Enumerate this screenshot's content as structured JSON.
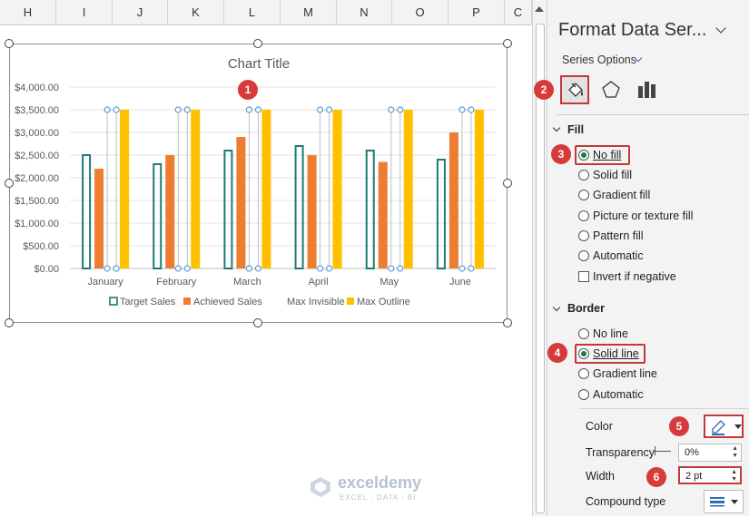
{
  "spreadsheet": {
    "columns": [
      "H",
      "I",
      "J",
      "K",
      "L",
      "M",
      "N",
      "O",
      "P",
      "C"
    ]
  },
  "chart_data": {
    "type": "bar",
    "title": "Chart Title",
    "categories": [
      "January",
      "February",
      "March",
      "April",
      "May",
      "June"
    ],
    "ylim": [
      0,
      4000
    ],
    "yticks": [
      "$0.00",
      "$500.00",
      "$1,000.00",
      "$1,500.00",
      "$2,000.00",
      "$2,500.00",
      "$3,000.00",
      "$3,500.00",
      "$4,000.00"
    ],
    "ytick_values": [
      0,
      500,
      1000,
      1500,
      2000,
      2500,
      3000,
      3500,
      4000
    ],
    "grid": true,
    "legend_position": "bottom",
    "series": [
      {
        "name": "Target Sales",
        "values": [
          2500,
          2300,
          2600,
          2700,
          2600,
          2400
        ],
        "style": "outline",
        "color": "#1e7b75"
      },
      {
        "name": "Achieved Sales",
        "values": [
          2200,
          2500,
          2900,
          2500,
          2350,
          3000
        ],
        "style": "fill",
        "color": "#ed7d31"
      },
      {
        "name": "Max Invisible",
        "values": [
          3500,
          3500,
          3500,
          3500,
          3500,
          3500
        ],
        "style": "selected-nofill",
        "color": "#bfbfbf"
      },
      {
        "name": "Max Outline",
        "values": [
          3500,
          3500,
          3500,
          3500,
          3500,
          3500
        ],
        "style": "fill",
        "color": "#ffc000"
      }
    ]
  },
  "panel": {
    "title": "Format Data Ser...",
    "series_options": "Series Options",
    "tabs": [
      {
        "name": "fill-line-icon"
      },
      {
        "name": "effects-icon"
      },
      {
        "name": "series-options-icon"
      }
    ],
    "fill": {
      "header": "Fill",
      "options": [
        "No fill",
        "Solid fill",
        "Gradient fill",
        "Picture or texture fill",
        "Pattern fill",
        "Automatic"
      ],
      "selected": "No fill",
      "invert_label": "Invert if negative"
    },
    "border": {
      "header": "Border",
      "options": [
        "No line",
        "Solid line",
        "Gradient line",
        "Automatic"
      ],
      "selected": "Solid line",
      "color_label": "Color",
      "transparency_label": "Transparency",
      "transparency_value": "0%",
      "width_label": "Width",
      "width_value": "2 pt",
      "compound_label": "Compound type"
    }
  },
  "callouts": [
    "1",
    "2",
    "3",
    "4",
    "5",
    "6"
  ],
  "watermark": {
    "name": "exceldemy",
    "tagline": "EXCEL · DATA · BI"
  },
  "colors": {
    "highlight": "#c03a3a",
    "badge": "#d63a3a",
    "accent": "#2f6db5"
  }
}
